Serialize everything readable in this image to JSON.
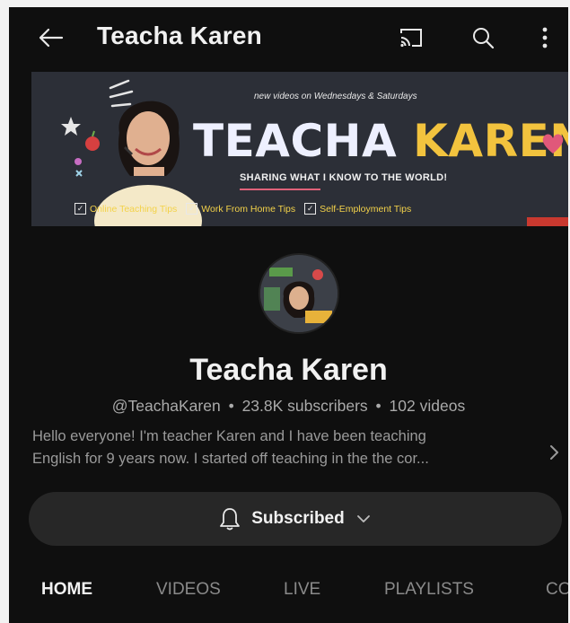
{
  "header": {
    "title": "Teacha Karen",
    "icons": [
      "back-arrow-icon",
      "cast-icon",
      "search-icon",
      "more-vert-icon"
    ]
  },
  "banner": {
    "tagline": "new videos on Wednesdays & Saturdays",
    "title_word1": "TEACHA",
    "title_word2": "KAREN",
    "subtitle": "SHARING WHAT I KNOW TO THE WORLD!",
    "tips": [
      {
        "label": "Online Teaching Tips"
      },
      {
        "label": "Work From Home Tips"
      },
      {
        "label": "Self-Employment Tips"
      }
    ]
  },
  "channel": {
    "name": "Teacha Karen",
    "handle": "@TeachaKaren",
    "separator": "•",
    "subscribers": "23.8K subscribers",
    "videos": "102 videos",
    "description_line1": "Hello everyone! I'm teacher Karen and I have been teaching",
    "description_line2": "English for 9 years now. I started off teaching in the the cor..."
  },
  "subscribe": {
    "label": "Subscribed"
  },
  "tabs": [
    {
      "label": "HOME",
      "active": true
    },
    {
      "label": "VIDEOS",
      "active": false
    },
    {
      "label": "LIVE",
      "active": false
    },
    {
      "label": "PLAYLISTS",
      "active": false
    },
    {
      "label": "CO",
      "active": false
    }
  ],
  "colors": {
    "background": "#0f0f0f",
    "text_primary": "#f1f1f1",
    "text_secondary": "#aaaaaa",
    "button_bg": "#272727",
    "banner_bg": "#2c2f37",
    "banner_accent": "#f2c33e"
  }
}
